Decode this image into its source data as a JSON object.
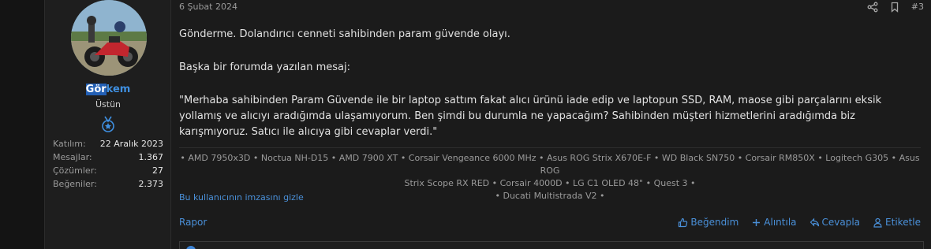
{
  "user": {
    "name_part1": "Gör",
    "name_part2": "kem",
    "title": "Üstün",
    "badge_icon": "medal-icon",
    "stats": [
      {
        "label": "Katılım:",
        "value": "22 Aralık 2023"
      },
      {
        "label": "Mesajlar:",
        "value": "1.367"
      },
      {
        "label": "Çözümler:",
        "value": "27"
      },
      {
        "label": "Beğeniler:",
        "value": "2.373"
      }
    ]
  },
  "post": {
    "date": "6 Şubat 2024",
    "number": "#3",
    "paragraphs": [
      "Gönderme. Dolandırıcı cenneti sahibinden param güvende olayı.",
      "Başka bir forumda yazılan mesaj:",
      "\"Merhaba sahibinden Param Güvende ile bir laptop sattım fakat alıcı ürünü iade edip ve laptopun SSD, RAM, maose gibi parçalarını eksik yollamış ve alıcıyı aradığımda ulaşamıyorum. Ben şimdi bu durumla ne yapacağım? Sahibinden müşteri hizmetlerini aradığımda biz karışmıyoruz. Satıcı ile alıcıya gibi cevaplar verdi.\""
    ],
    "signature_lines": [
      "• AMD 7950x3D • Noctua NH-D15 • AMD 7900 XT • Corsair Vengeance 6000 MHz • Asus ROG Strix X670E-F • WD Black SN750 • Corsair RM850X • Logitech G305 • Asus ROG",
      "Strix Scope RX RED • Corsair 4000D • LG C1 OLED 48\" • Quest 3 •",
      "• Ducati Multistrada V2 •"
    ],
    "signature_toggle": "Bu kullanıcının imzasını gizle"
  },
  "actions": {
    "report": "Rapor",
    "like": "Beğendim",
    "quote": "Alıntıla",
    "reply": "Cevapla",
    "tag": "Etiketle"
  },
  "colors": {
    "accent": "#4a90d9",
    "username": "#3f8fe0",
    "background": "#1b1b1b"
  }
}
